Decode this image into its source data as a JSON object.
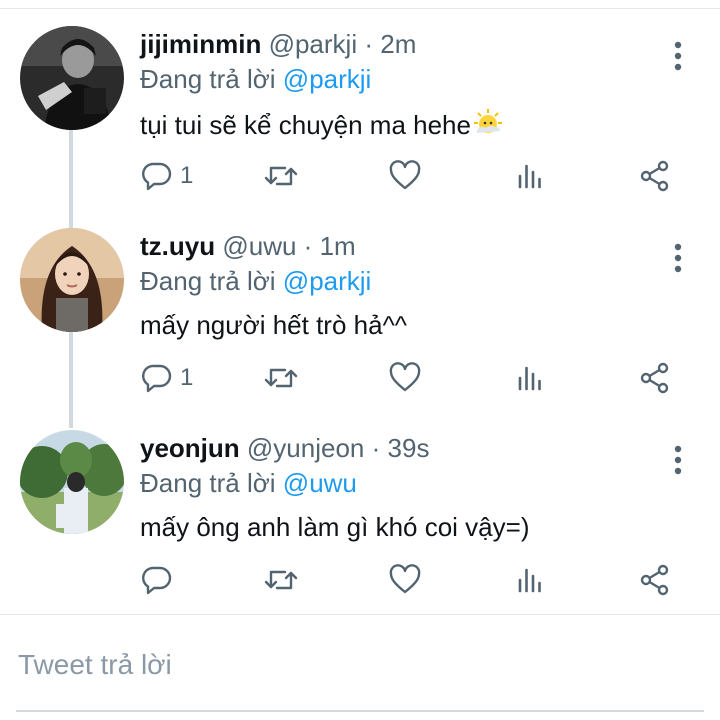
{
  "tweets": [
    {
      "name": "jijiminmin",
      "handle": "@parkji",
      "separator": "·",
      "time": "2m",
      "reply_prefix": "Đang trả lời",
      "reply_to": "@parkji",
      "text": "tụi tui sẽ kể chuyện ma hehe",
      "emoji": "sweat-sun-emoji",
      "reply_count": "1",
      "avatar": "avatar-dark-photo"
    },
    {
      "name": "tz.uyu",
      "handle": "@uwu",
      "separator": "·",
      "time": "1m",
      "reply_prefix": "Đang trả lời",
      "reply_to": "@parkji",
      "text": "mấy người hết trò hả^^",
      "reply_count": "1",
      "avatar": "avatar-girl-photo"
    },
    {
      "name": "yeonjun",
      "handle": "@yunjeon",
      "separator": "·",
      "time": "39s",
      "reply_prefix": "Đang trả lời",
      "reply_to": "@uwu",
      "text": "mấy ông anh làm gì khó coi vậy=)",
      "reply_count": "",
      "avatar": "avatar-park-photo"
    }
  ],
  "compose": {
    "placeholder": "Tweet trả lời"
  },
  "icons": {
    "more": "more-vertical-icon",
    "reply": "reply-bubble-icon",
    "retweet": "retweet-icon",
    "like": "heart-icon",
    "stats": "stats-icon",
    "share": "share-icon"
  },
  "colors": {
    "link": "#1d9bf0",
    "muted": "#536471",
    "text": "#0f1419",
    "thread_line": "#cfd9de"
  }
}
